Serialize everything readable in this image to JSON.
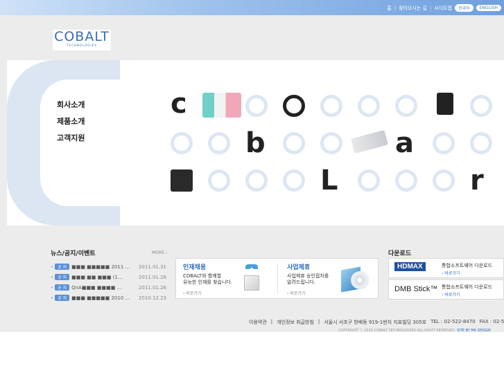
{
  "topnav": {
    "home": "홈",
    "directions": "찾아오시는 길",
    "sitemap": "사이트맵",
    "lang_korean": "한국어",
    "lang_english": "ENGLISH"
  },
  "logo": {
    "name": "COBALT",
    "sub": "TECHNOLOGIES"
  },
  "menu": [
    "회사소개",
    "제품소개",
    "고객지원"
  ],
  "news": {
    "title": "뉴스/공지/이벤트",
    "more": "MORE ›",
    "tag": "공 지",
    "items": [
      {
        "title": "■■■ ■■■■■ 2011 ...",
        "date": "2011.01.31"
      },
      {
        "title": "■■■ ■■ ■■■ (1...",
        "date": "2011.01.28"
      },
      {
        "title": "QnA■■■ ■■■■ ...",
        "date": "2011.01.26"
      },
      {
        "title": "■■■ ■■■■■ 2010 ...",
        "date": "2010.12.23"
      }
    ]
  },
  "recruit": {
    "title": "인재채용",
    "text1": "COBALT와 함께할",
    "text2": "유능한 인재를 찾습니다.",
    "link": "› 바로가기"
  },
  "business": {
    "title": "사업제휴",
    "text1": "사업제휴 승인접차를",
    "text2": "알려드립니다.",
    "link": "› 바로가기"
  },
  "downloads": {
    "title": "다운로드",
    "items": [
      {
        "brand": "HDMAX",
        "desc": "통합소프트웨어 다운로드",
        "link": "› 바로가기"
      },
      {
        "brand": "DMB Stick™",
        "desc": "통합소프트웨어 다운로드",
        "link": "› 바로가기"
      }
    ]
  },
  "footer": {
    "terms": "이용약관",
    "privacy": "개인정보 취급방침",
    "address": "서울시 서초구 방배동 919-1번지 지효빌딩 305호",
    "tel": "TEL : 02-522-8470",
    "fax": "FAX : 02-522-8469",
    "copyright": "COPYRIGHT ⓒ 2010 COBALT TECHNOLOGIES ALL RIGHT RESERVED.",
    "credit": "SITE BY MK DESIGN"
  },
  "colors": {
    "accent": "#2e6bbf",
    "topbar": "#8fb6e8",
    "ring": "#dde7f3"
  }
}
